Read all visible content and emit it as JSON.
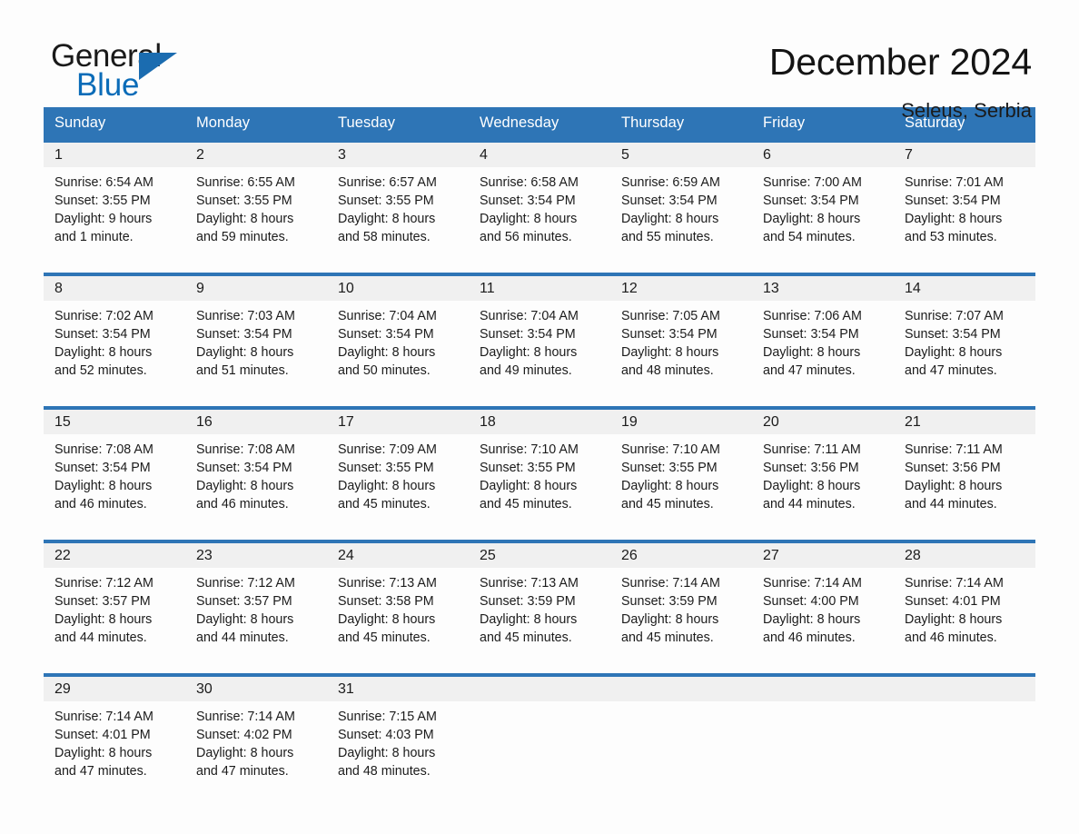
{
  "brand": {
    "name_part1": "General",
    "name_part2": "Blue",
    "flag_icon": "triangle-flag-icon"
  },
  "header": {
    "month_title": "December 2024",
    "location": "Seleus, Serbia"
  },
  "weekday_headers": [
    "Sunday",
    "Monday",
    "Tuesday",
    "Wednesday",
    "Thursday",
    "Friday",
    "Saturday"
  ],
  "colors": {
    "header_blue": "#2e75b6",
    "brand_blue": "#0b6cb8",
    "daynum_band": "#f0f0f0",
    "page_background": "#fdfdfd",
    "text": "#1b1b1b"
  },
  "weeks": [
    {
      "days": [
        {
          "num": "1",
          "sunrise": "Sunrise: 6:54 AM",
          "sunset": "Sunset: 3:55 PM",
          "daylight_l1": "Daylight: 9 hours",
          "daylight_l2": "and 1 minute."
        },
        {
          "num": "2",
          "sunrise": "Sunrise: 6:55 AM",
          "sunset": "Sunset: 3:55 PM",
          "daylight_l1": "Daylight: 8 hours",
          "daylight_l2": "and 59 minutes."
        },
        {
          "num": "3",
          "sunrise": "Sunrise: 6:57 AM",
          "sunset": "Sunset: 3:55 PM",
          "daylight_l1": "Daylight: 8 hours",
          "daylight_l2": "and 58 minutes."
        },
        {
          "num": "4",
          "sunrise": "Sunrise: 6:58 AM",
          "sunset": "Sunset: 3:54 PM",
          "daylight_l1": "Daylight: 8 hours",
          "daylight_l2": "and 56 minutes."
        },
        {
          "num": "5",
          "sunrise": "Sunrise: 6:59 AM",
          "sunset": "Sunset: 3:54 PM",
          "daylight_l1": "Daylight: 8 hours",
          "daylight_l2": "and 55 minutes."
        },
        {
          "num": "6",
          "sunrise": "Sunrise: 7:00 AM",
          "sunset": "Sunset: 3:54 PM",
          "daylight_l1": "Daylight: 8 hours",
          "daylight_l2": "and 54 minutes."
        },
        {
          "num": "7",
          "sunrise": "Sunrise: 7:01 AM",
          "sunset": "Sunset: 3:54 PM",
          "daylight_l1": "Daylight: 8 hours",
          "daylight_l2": "and 53 minutes."
        }
      ]
    },
    {
      "days": [
        {
          "num": "8",
          "sunrise": "Sunrise: 7:02 AM",
          "sunset": "Sunset: 3:54 PM",
          "daylight_l1": "Daylight: 8 hours",
          "daylight_l2": "and 52 minutes."
        },
        {
          "num": "9",
          "sunrise": "Sunrise: 7:03 AM",
          "sunset": "Sunset: 3:54 PM",
          "daylight_l1": "Daylight: 8 hours",
          "daylight_l2": "and 51 minutes."
        },
        {
          "num": "10",
          "sunrise": "Sunrise: 7:04 AM",
          "sunset": "Sunset: 3:54 PM",
          "daylight_l1": "Daylight: 8 hours",
          "daylight_l2": "and 50 minutes."
        },
        {
          "num": "11",
          "sunrise": "Sunrise: 7:04 AM",
          "sunset": "Sunset: 3:54 PM",
          "daylight_l1": "Daylight: 8 hours",
          "daylight_l2": "and 49 minutes."
        },
        {
          "num": "12",
          "sunrise": "Sunrise: 7:05 AM",
          "sunset": "Sunset: 3:54 PM",
          "daylight_l1": "Daylight: 8 hours",
          "daylight_l2": "and 48 minutes."
        },
        {
          "num": "13",
          "sunrise": "Sunrise: 7:06 AM",
          "sunset": "Sunset: 3:54 PM",
          "daylight_l1": "Daylight: 8 hours",
          "daylight_l2": "and 47 minutes."
        },
        {
          "num": "14",
          "sunrise": "Sunrise: 7:07 AM",
          "sunset": "Sunset: 3:54 PM",
          "daylight_l1": "Daylight: 8 hours",
          "daylight_l2": "and 47 minutes."
        }
      ]
    },
    {
      "days": [
        {
          "num": "15",
          "sunrise": "Sunrise: 7:08 AM",
          "sunset": "Sunset: 3:54 PM",
          "daylight_l1": "Daylight: 8 hours",
          "daylight_l2": "and 46 minutes."
        },
        {
          "num": "16",
          "sunrise": "Sunrise: 7:08 AM",
          "sunset": "Sunset: 3:54 PM",
          "daylight_l1": "Daylight: 8 hours",
          "daylight_l2": "and 46 minutes."
        },
        {
          "num": "17",
          "sunrise": "Sunrise: 7:09 AM",
          "sunset": "Sunset: 3:55 PM",
          "daylight_l1": "Daylight: 8 hours",
          "daylight_l2": "and 45 minutes."
        },
        {
          "num": "18",
          "sunrise": "Sunrise: 7:10 AM",
          "sunset": "Sunset: 3:55 PM",
          "daylight_l1": "Daylight: 8 hours",
          "daylight_l2": "and 45 minutes."
        },
        {
          "num": "19",
          "sunrise": "Sunrise: 7:10 AM",
          "sunset": "Sunset: 3:55 PM",
          "daylight_l1": "Daylight: 8 hours",
          "daylight_l2": "and 45 minutes."
        },
        {
          "num": "20",
          "sunrise": "Sunrise: 7:11 AM",
          "sunset": "Sunset: 3:56 PM",
          "daylight_l1": "Daylight: 8 hours",
          "daylight_l2": "and 44 minutes."
        },
        {
          "num": "21",
          "sunrise": "Sunrise: 7:11 AM",
          "sunset": "Sunset: 3:56 PM",
          "daylight_l1": "Daylight: 8 hours",
          "daylight_l2": "and 44 minutes."
        }
      ]
    },
    {
      "days": [
        {
          "num": "22",
          "sunrise": "Sunrise: 7:12 AM",
          "sunset": "Sunset: 3:57 PM",
          "daylight_l1": "Daylight: 8 hours",
          "daylight_l2": "and 44 minutes."
        },
        {
          "num": "23",
          "sunrise": "Sunrise: 7:12 AM",
          "sunset": "Sunset: 3:57 PM",
          "daylight_l1": "Daylight: 8 hours",
          "daylight_l2": "and 44 minutes."
        },
        {
          "num": "24",
          "sunrise": "Sunrise: 7:13 AM",
          "sunset": "Sunset: 3:58 PM",
          "daylight_l1": "Daylight: 8 hours",
          "daylight_l2": "and 45 minutes."
        },
        {
          "num": "25",
          "sunrise": "Sunrise: 7:13 AM",
          "sunset": "Sunset: 3:59 PM",
          "daylight_l1": "Daylight: 8 hours",
          "daylight_l2": "and 45 minutes."
        },
        {
          "num": "26",
          "sunrise": "Sunrise: 7:14 AM",
          "sunset": "Sunset: 3:59 PM",
          "daylight_l1": "Daylight: 8 hours",
          "daylight_l2": "and 45 minutes."
        },
        {
          "num": "27",
          "sunrise": "Sunrise: 7:14 AM",
          "sunset": "Sunset: 4:00 PM",
          "daylight_l1": "Daylight: 8 hours",
          "daylight_l2": "and 46 minutes."
        },
        {
          "num": "28",
          "sunrise": "Sunrise: 7:14 AM",
          "sunset": "Sunset: 4:01 PM",
          "daylight_l1": "Daylight: 8 hours",
          "daylight_l2": "and 46 minutes."
        }
      ]
    },
    {
      "days": [
        {
          "num": "29",
          "sunrise": "Sunrise: 7:14 AM",
          "sunset": "Sunset: 4:01 PM",
          "daylight_l1": "Daylight: 8 hours",
          "daylight_l2": "and 47 minutes."
        },
        {
          "num": "30",
          "sunrise": "Sunrise: 7:14 AM",
          "sunset": "Sunset: 4:02 PM",
          "daylight_l1": "Daylight: 8 hours",
          "daylight_l2": "and 47 minutes."
        },
        {
          "num": "31",
          "sunrise": "Sunrise: 7:15 AM",
          "sunset": "Sunset: 4:03 PM",
          "daylight_l1": "Daylight: 8 hours",
          "daylight_l2": "and 48 minutes."
        },
        {
          "num": "",
          "sunrise": "",
          "sunset": "",
          "daylight_l1": "",
          "daylight_l2": ""
        },
        {
          "num": "",
          "sunrise": "",
          "sunset": "",
          "daylight_l1": "",
          "daylight_l2": ""
        },
        {
          "num": "",
          "sunrise": "",
          "sunset": "",
          "daylight_l1": "",
          "daylight_l2": ""
        },
        {
          "num": "",
          "sunrise": "",
          "sunset": "",
          "daylight_l1": "",
          "daylight_l2": ""
        }
      ]
    }
  ]
}
